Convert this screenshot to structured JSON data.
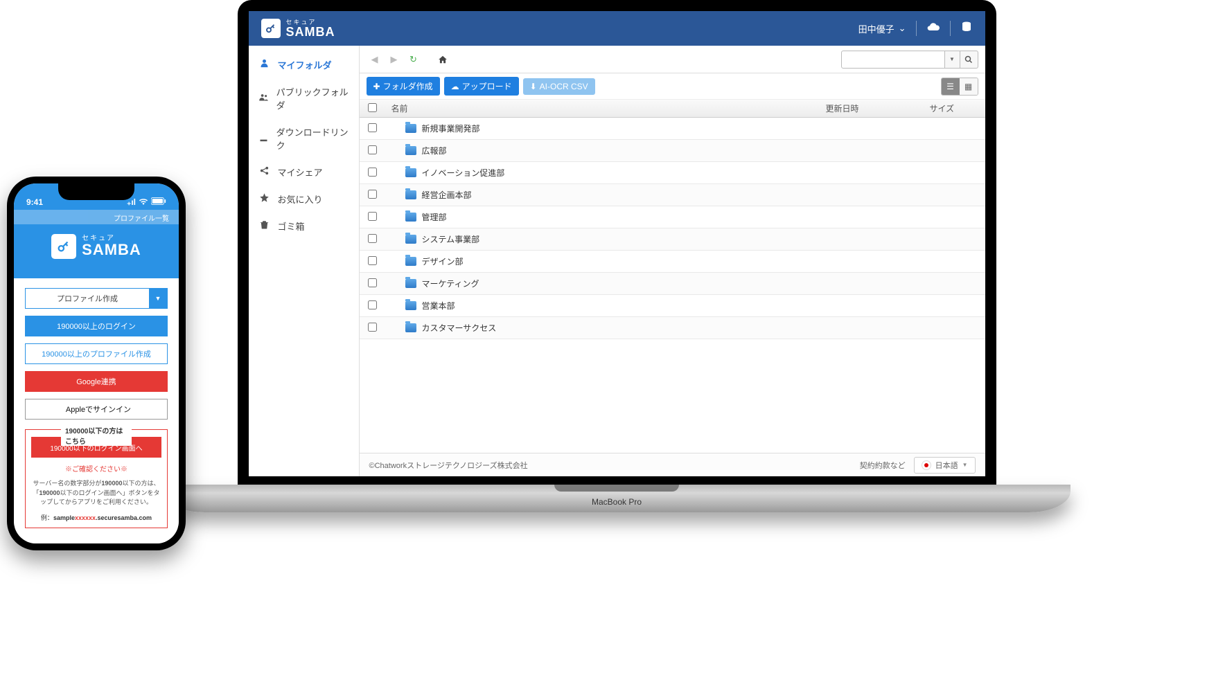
{
  "header": {
    "logo_sub": "セキュア",
    "logo_main": "SAMBA",
    "user": "田中優子"
  },
  "sidebar": [
    {
      "icon": "person-icon",
      "label": "マイフォルダ",
      "active": true
    },
    {
      "icon": "people-icon",
      "label": "パブリックフォルダ",
      "active": false
    },
    {
      "icon": "download-icon",
      "label": "ダウンロードリンク",
      "active": false
    },
    {
      "icon": "share-icon",
      "label": "マイシェア",
      "active": false
    },
    {
      "icon": "star-icon",
      "label": "お気に入り",
      "active": false
    },
    {
      "icon": "trash-icon",
      "label": "ゴミ箱",
      "active": false
    }
  ],
  "actions": {
    "create_folder": "フォルダ作成",
    "upload": "アップロード",
    "ai_ocr": "AI-OCR CSV"
  },
  "columns": {
    "name": "名前",
    "date": "更新日時",
    "size": "サイズ"
  },
  "folders": [
    "新規事業開発部",
    "広報部",
    "イノベーション促進部",
    "経営企画本部",
    "管理部",
    "システム事業部",
    "デザイン部",
    "マーケティング",
    "営業本部",
    "カスタマーサクセス"
  ],
  "footer": {
    "copyright": "©Chatworkストレージテクノロジーズ株式会社",
    "terms": "契約約款など",
    "lang": "日本語"
  },
  "laptop_label": "MacBook Pro",
  "phone": {
    "time": "9:41",
    "banner": "プロファイル一覧",
    "profile_create": "プロファイル作成",
    "login_190000_up": "190000以上のログイン",
    "profile_190000_up": "190000以上のプロファイル作成",
    "google": "Google連携",
    "apple": "Appleでサインイン",
    "box_title": "190000以下の方はこちら",
    "to_login_below": "190000以下のログイン画面へ",
    "warn": "※ご確認ください※",
    "note_1": "サーバー名の数字部分が",
    "note_2": "190000",
    "note_3": "以下の方は、「",
    "note_4": "190000",
    "note_5": "以下のログイン画面へ」ボタンをタップしてからアプリをご利用ください。",
    "example_label": "例：",
    "example_pre": "sample",
    "example_num": "xxxxxx",
    "example_suf": ".securesamba.com"
  }
}
